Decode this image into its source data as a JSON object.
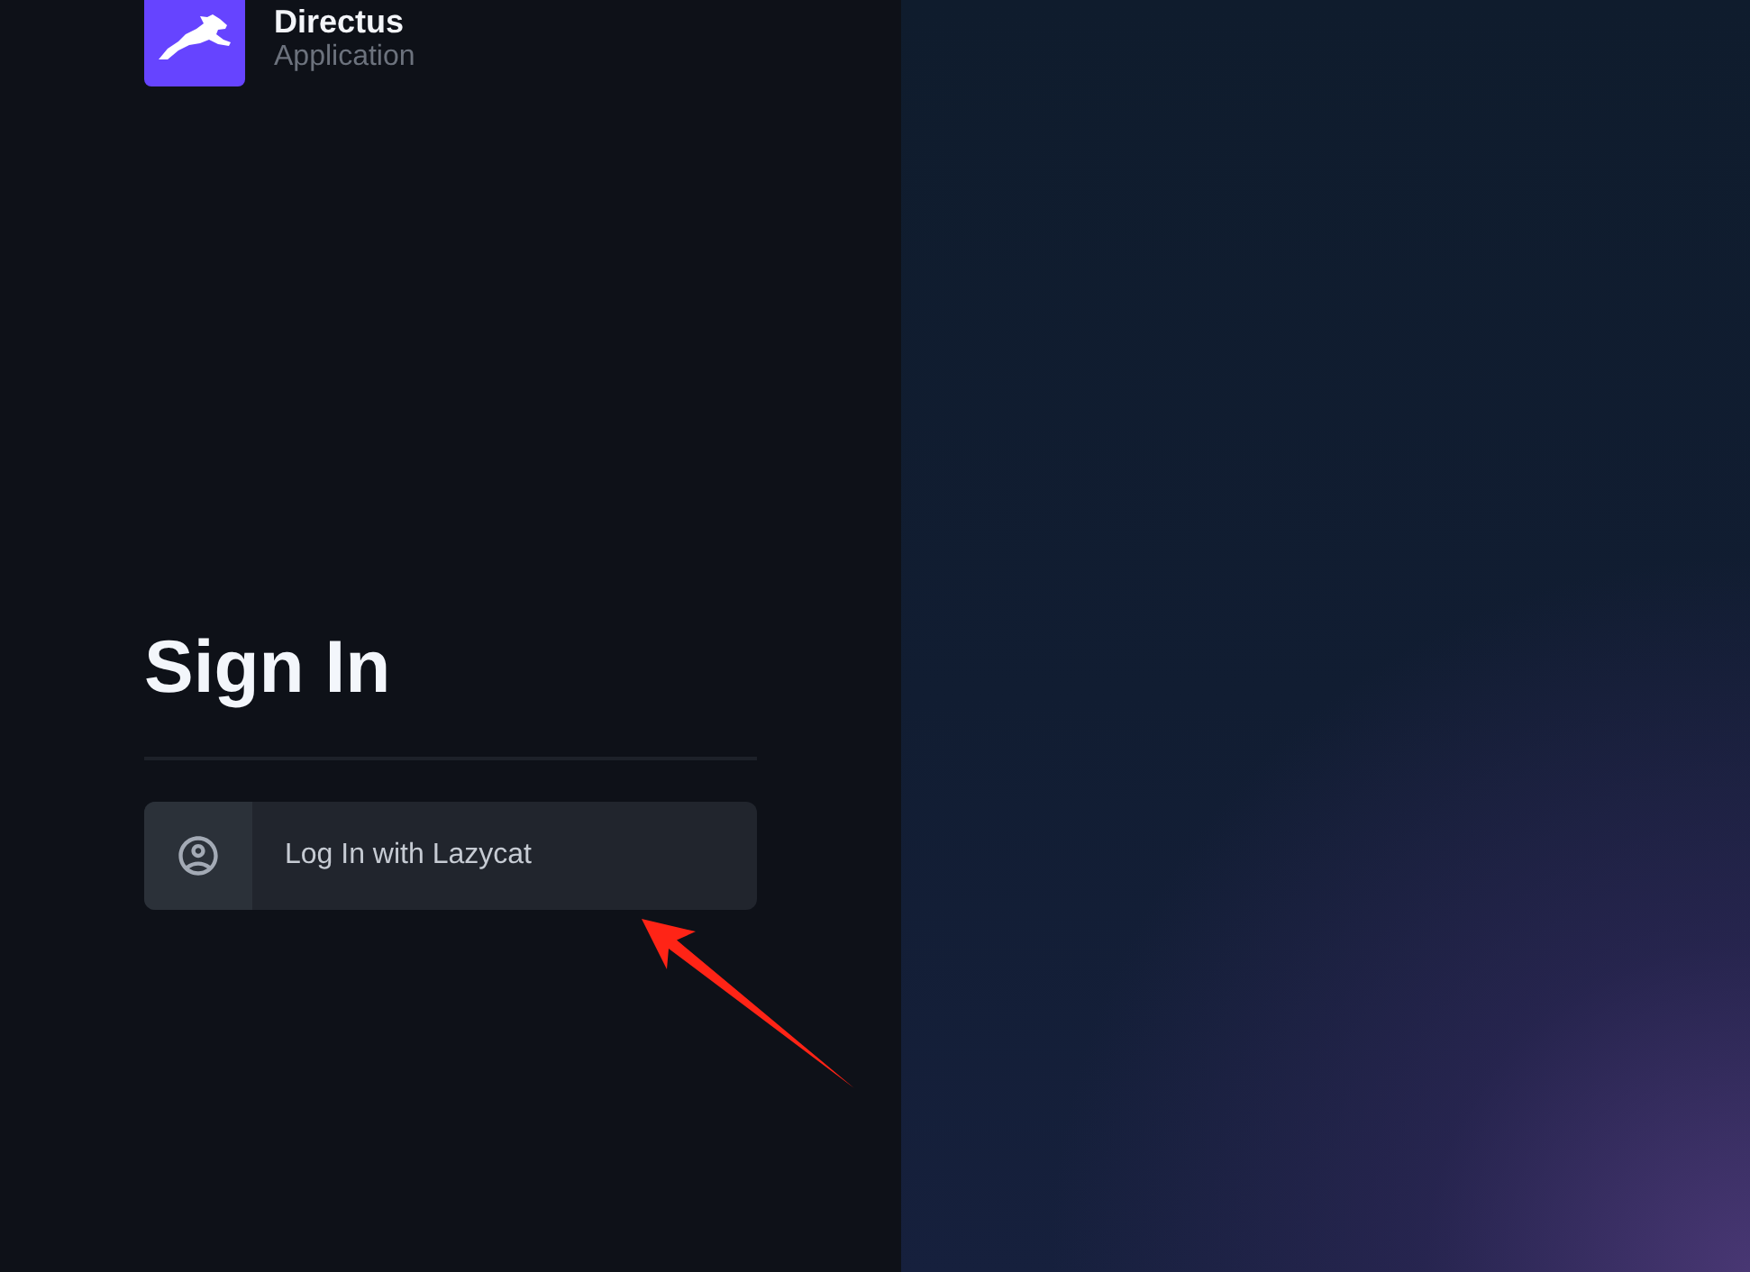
{
  "brand": {
    "name": "Directus",
    "subtitle": "Application"
  },
  "heading": "Sign In",
  "login_buttons": [
    {
      "label": "Log In with Lazycat"
    }
  ]
}
